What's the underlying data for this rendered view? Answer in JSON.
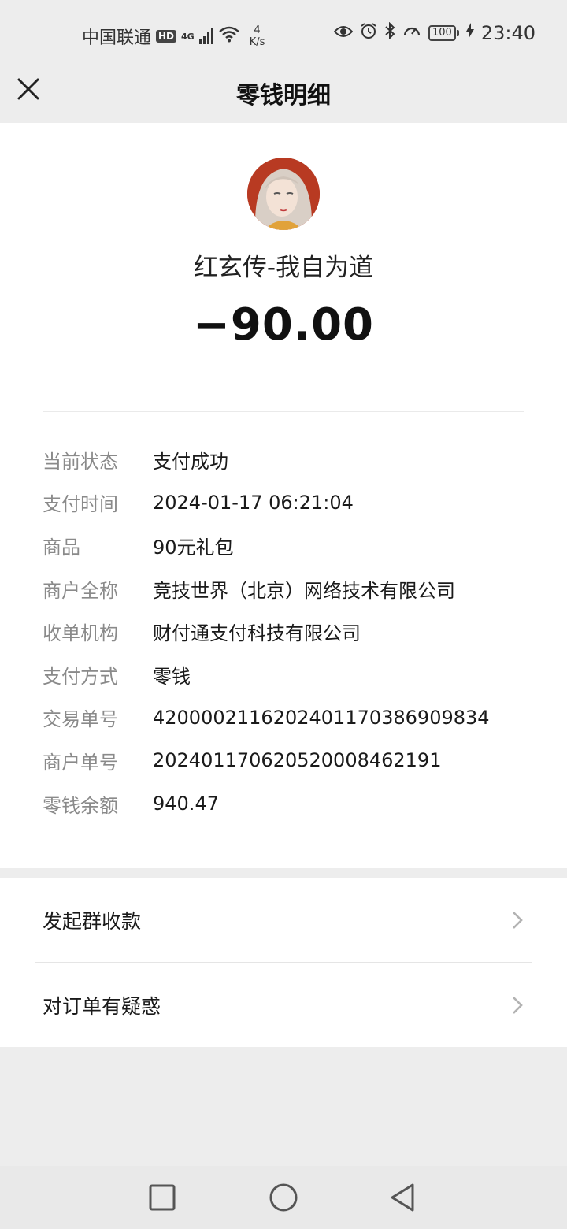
{
  "status_bar": {
    "carrier": "中国联通",
    "hd_badge": "HD",
    "network_type": "4G",
    "speed_value": "4",
    "speed_unit": "K/s",
    "battery": "100",
    "time": "23:40"
  },
  "header": {
    "title": "零钱明细",
    "close_icon": "close-icon"
  },
  "transaction": {
    "merchant_name": "红玄传-我自为道",
    "amount": "−90.00"
  },
  "details": [
    {
      "label": "当前状态",
      "value": "支付成功"
    },
    {
      "label": "支付时间",
      "value": "2024-01-17 06:21:04"
    },
    {
      "label": "商品",
      "value": "90元礼包"
    },
    {
      "label": "商户全称",
      "value": "竞技世界（北京）网络技术有限公司"
    },
    {
      "label": "收单机构",
      "value": "财付通支付科技有限公司"
    },
    {
      "label": "支付方式",
      "value": "零钱"
    },
    {
      "label": "交易单号",
      "value": "4200002116202401170386909834"
    },
    {
      "label": "商户单号",
      "value": "20240117062052000846219​1"
    },
    {
      "label": "零钱余额",
      "value": "940.47"
    }
  ],
  "actions": [
    {
      "label": "发起群收款"
    },
    {
      "label": "对订单有疑惑"
    }
  ],
  "nav": {
    "recent_icon": "square-icon",
    "home_icon": "circle-icon",
    "back_icon": "triangle-back-icon"
  }
}
